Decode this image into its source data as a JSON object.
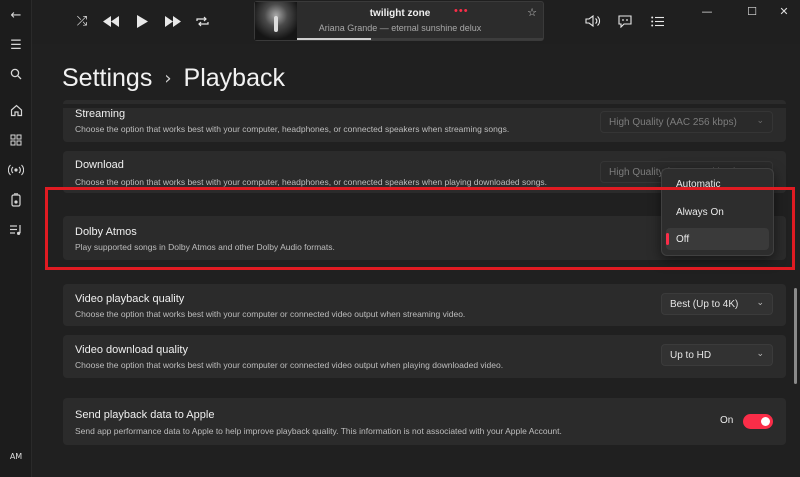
{
  "sidebar": {
    "icons": [
      "back-icon",
      "menu-icon",
      "search-icon",
      "home-icon",
      "grid-icon",
      "radio-icon",
      "library-icon",
      "playlist-icon"
    ],
    "avatar": "AM"
  },
  "player": {
    "track_title": "twilight zone",
    "track_subtitle": "Ariana Grande — eternal sunshine delux",
    "more_label": "•••",
    "progress": 0.3
  },
  "page": {
    "title": "Settings",
    "separator": "›",
    "subtitle": "Playback"
  },
  "settings": {
    "streaming": {
      "title": "Streaming",
      "description": "Choose the option that works best with your computer, headphones, or connected speakers when streaming songs.",
      "value": "High Quality (AAC 256 kbps)"
    },
    "download": {
      "title": "Download",
      "description": "Choose the option that works best with your computer, headphones, or connected speakers when playing downloaded songs.",
      "value": "High Quality (AAC 256 kbps)"
    },
    "dolby": {
      "title": "Dolby Atmos",
      "description": "Play supported songs in Dolby Atmos and other Dolby Audio formats.",
      "options": [
        "Automatic",
        "Always On",
        "Off"
      ],
      "selected": "Off"
    },
    "video_playback": {
      "title": "Video playback quality",
      "description": "Choose the option that works best with your computer or connected video output when streaming video.",
      "value": "Best (Up to 4K)"
    },
    "video_download": {
      "title": "Video download quality",
      "description": "Choose the option that works best with your computer or connected video output when playing downloaded video.",
      "value": "Up to HD"
    },
    "send_data": {
      "title": "Send playback data to Apple",
      "description": "Send app performance data to Apple to help improve playback quality. This information is not associated with your Apple Account.",
      "toggle_label": "On",
      "enabled": true
    }
  },
  "colors": {
    "accent": "#fa2d48",
    "highlight_box": "#e01b22",
    "background": "#202020",
    "card": "#2b2b2b"
  }
}
